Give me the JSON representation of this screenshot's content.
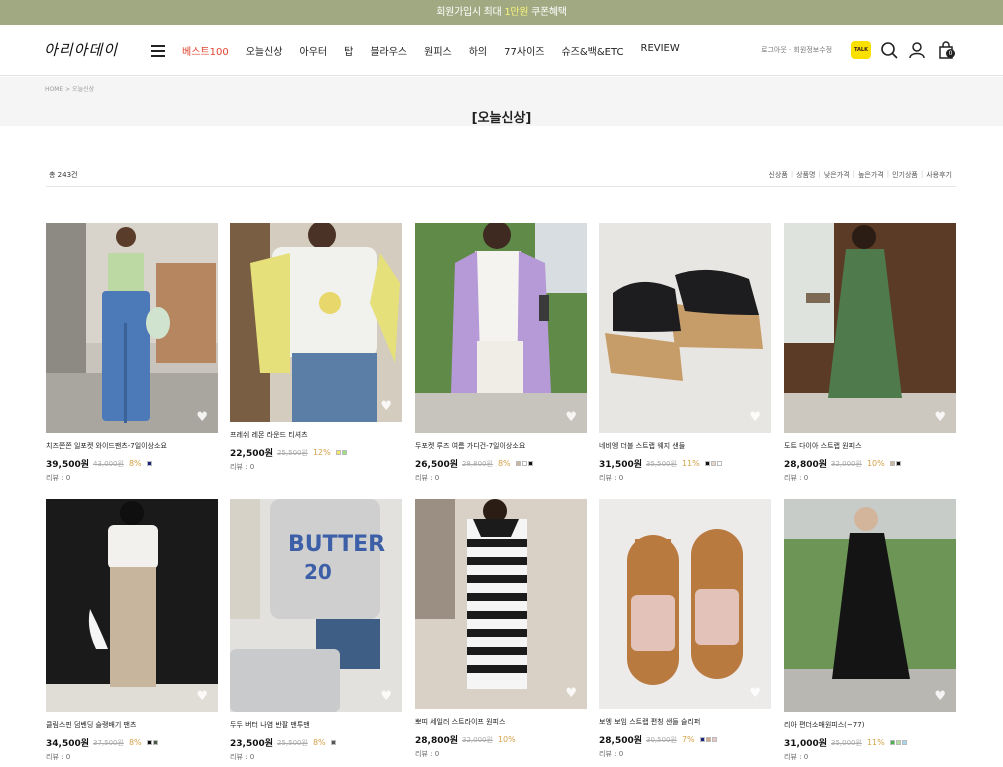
{
  "topbar": {
    "pre": "회원가입시 최대 ",
    "highlight": "1만원",
    "post": " 쿠폰혜택"
  },
  "header": {
    "logo": "아리아데이",
    "nav": [
      "베스트100",
      "오늘신상",
      "아우터",
      "탑",
      "블라우스",
      "원피스",
      "하의",
      "77사이즈",
      "슈즈&백&ETC",
      "REVIEW"
    ],
    "util": "로그아웃  ·  회원정보수정",
    "kakao_label": "TALK",
    "cart_count": "0"
  },
  "breadcrumb": "HOME  >  오늘신상",
  "page_title": "[오늘신상]",
  "count_text": "총 243건",
  "sort_options": [
    "신상품",
    "상품명",
    "낮은가격",
    "높은가격",
    "인기상품",
    "사용후기"
  ],
  "colors": {
    "topbar": "#a0a982",
    "best_menu": "#e0442f",
    "discount": "#d4a24a"
  },
  "products": [
    {
      "name": "치즈쫀쫀 일포켓 와이드팬츠-7일이상소요",
      "price": "39,500원",
      "original": "43,000원",
      "discount": "8%",
      "review": "리뷰 : 0",
      "swatches": [
        "#1a237e"
      ]
    },
    {
      "name": "프레쉬 레몬 라운드 티셔츠",
      "price": "22,500원",
      "original": "25,500원",
      "discount": "12%",
      "review": "리뷰 : 0",
      "swatches": [
        "#f5e663",
        "#9be07a"
      ]
    },
    {
      "name": "두포켓 루즈 여름 가디건-7일이상소요",
      "price": "26,500원",
      "original": "28,800원",
      "discount": "8%",
      "review": "리뷰 : 0",
      "swatches": [
        "#c9b79c",
        "#ffffff",
        "#111111"
      ]
    },
    {
      "name": "네비엥 더블 스트랩 웨지 샌들",
      "price": "31,500원",
      "original": "35,500원",
      "discount": "11%",
      "review": "리뷰 : 0",
      "swatches": [
        "#111111",
        "#e8d9cc",
        "#ffffff"
      ]
    },
    {
      "name": "도트 다이아 스트랩 원피스",
      "price": "28,800원",
      "original": "32,000원",
      "discount": "10%",
      "review": "리뷰 : 0",
      "swatches": [
        "#c9b79c",
        "#111111"
      ]
    },
    {
      "name": "클림스핀 덤벤딩 슬랭배기 팬츠",
      "price": "34,500원",
      "original": "37,500원",
      "discount": "8%",
      "review": "리뷰 : 0",
      "swatches": [
        "#111111",
        "#4a5a45"
      ]
    },
    {
      "name": "두두 버터 나염 반팔 맨투맨",
      "price": "23,500원",
      "original": "25,500원",
      "discount": "8%",
      "review": "리뷰 : 0",
      "swatches": [
        "#555555"
      ]
    },
    {
      "name": "뽀띠 세일러 스트라이프 원피스",
      "price": "28,800원",
      "original": "32,000원",
      "discount": "10%",
      "review": "리뷰 : 0",
      "swatches": []
    },
    {
      "name": "보엥 보임 스트랩 편칭 샌들 슬리퍼",
      "price": "28,500원",
      "original": "30,500원",
      "discount": "7%",
      "review": "리뷰 : 0",
      "swatches": [
        "#1a237e",
        "#d3a88a",
        "#e8c4c4"
      ]
    },
    {
      "name": "리아 편더소매원피스(~77)",
      "price": "31,000원",
      "original": "35,000원",
      "discount": "11%",
      "review": "리뷰 : 0",
      "swatches": [
        "#4caf50",
        "#b6e3a0",
        "#a5d8ef"
      ]
    }
  ]
}
